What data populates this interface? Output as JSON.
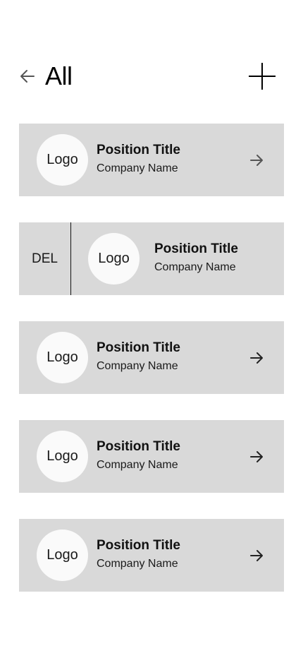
{
  "header": {
    "title": "All",
    "back_icon": "arrow-left-icon",
    "add_icon": "plus-icon"
  },
  "cards": [
    {
      "logo": "Logo",
      "title": "Position Title",
      "company": "Company Name"
    },
    {
      "delete_label": "DEL",
      "logo": "Logo",
      "title": "Position Title",
      "company": "Company Name"
    },
    {
      "logo": "Logo",
      "title": "Position Title",
      "company": "Company Name"
    },
    {
      "logo": "Logo",
      "title": "Position Title",
      "company": "Company Name"
    },
    {
      "logo": "Logo",
      "title": "Position Title",
      "company": "Company Name"
    }
  ],
  "colors": {
    "card_background": "#d9d9d9",
    "logo_background": "#fafafa",
    "text": "#000000"
  }
}
